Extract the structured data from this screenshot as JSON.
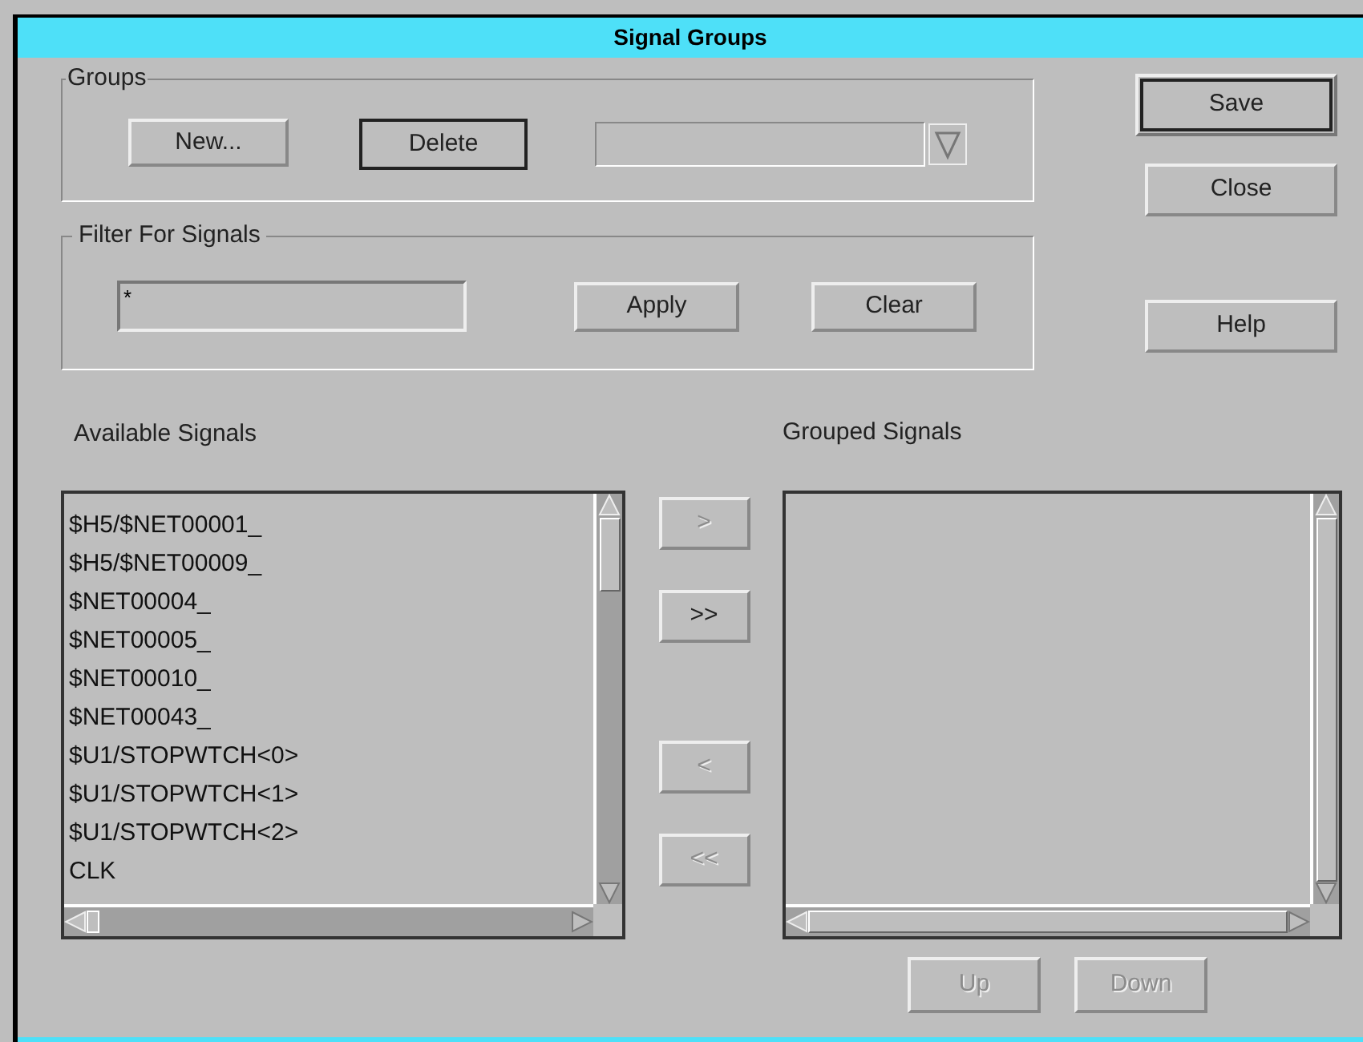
{
  "window": {
    "title": "Signal Groups"
  },
  "groups": {
    "label": "Groups",
    "buttons": [
      {
        "label": "New...",
        "default": false
      },
      {
        "label": "Delete",
        "default": true
      }
    ]
  },
  "filter": {
    "label": "Filter For Signals",
    "value": "*",
    "buttons": [
      {
        "label": "Apply",
        "disabled": false
      },
      {
        "label": "Clear",
        "disabled": false
      }
    ]
  },
  "side_buttons": [
    {
      "label": "Save",
      "default": true
    },
    {
      "label": "Close",
      "default": false
    },
    {
      "label": "Help",
      "default": false
    }
  ],
  "available": {
    "label": "Available Signals",
    "items": [
      "$H5/$NET00001_",
      "$H5/$NET00009_",
      "$NET00004_",
      "$NET00005_",
      "$NET00010_",
      "$NET00043_",
      "$U1/STOPWTCH<0>",
      "$U1/STOPWTCH<1>",
      "$U1/STOPWTCH<2>",
      "CLK"
    ]
  },
  "transfer_buttons": [
    {
      "label": ">",
      "disabled": true
    },
    {
      "label": ">>",
      "disabled": false
    },
    {
      "label": "<",
      "disabled": true
    },
    {
      "label": "<<",
      "disabled": true
    }
  ],
  "grouped": {
    "label": "Grouped Signals"
  },
  "order_buttons": [
    {
      "label": "Up",
      "disabled": true
    },
    {
      "label": "Down",
      "disabled": true
    }
  ]
}
